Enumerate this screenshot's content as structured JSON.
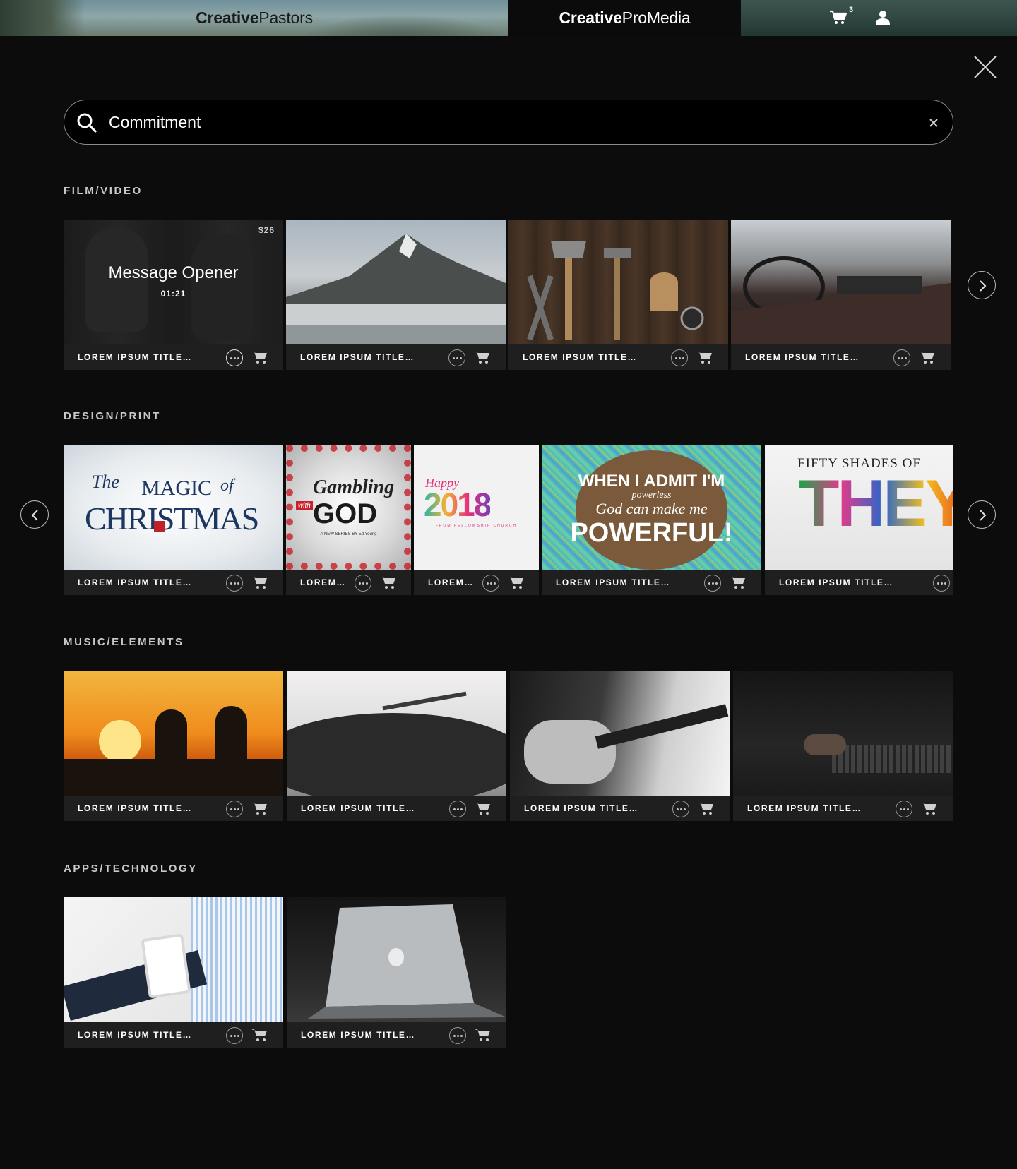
{
  "header": {
    "brand_left": {
      "bold": "Creative",
      "light": "Pastors"
    },
    "brand_center": {
      "bold": "Creative",
      "light": "ProMedia"
    },
    "cart_count": "3",
    "icons": [
      "cart-icon",
      "user-icon",
      "close-icon"
    ]
  },
  "search": {
    "value": "Commitment",
    "icon": "search-icon",
    "clear_icon": "clear-icon"
  },
  "sections": {
    "film": {
      "title": "FILM/VIDEO",
      "items": [
        {
          "title": "LOREM IPSUM TITLE…",
          "overlay_title": "Message Opener",
          "duration": "01:21",
          "price": "$26"
        },
        {
          "title": "LOREM IPSUM TITLE…"
        },
        {
          "title": "LOREM IPSUM TITLE…"
        },
        {
          "title": "LOREM IPSUM TITLE…"
        }
      ]
    },
    "design": {
      "title": "DESIGN/PRINT",
      "items": [
        {
          "title": "LOREM IPSUM TITLE…",
          "art_line1": "The",
          "art_line2": "MAGIC",
          "art_line3": "of",
          "art_line4": "CHRISTMAS"
        },
        {
          "title": "LOREM…",
          "art_line1": "Gambling",
          "art_line2": "with",
          "art_line3": "GOD",
          "art_line4": "A NEW SERIES BY Ed Young"
        },
        {
          "title": "LOREM…",
          "art_line1": "Happy",
          "art_line2": "2018",
          "art_line3": "FROM FELLOWSHIP CHURCH"
        },
        {
          "title": "LOREM IPSUM TITLE…",
          "art_line1": "WHEN I ADMIT I'M",
          "art_line2": "powerless",
          "art_line3": "God can make me",
          "art_line4": "POWERFUL!"
        },
        {
          "title": "LOREM IPSUM TITLE…",
          "art_line1": "FIFTY SHADES OF",
          "art_line2": "THEY"
        }
      ]
    },
    "music": {
      "title": "MUSIC/ELEMENTS",
      "items": [
        {
          "title": "LOREM IPSUM TITLE…"
        },
        {
          "title": "LOREM IPSUM TITLE…"
        },
        {
          "title": "LOREM IPSUM TITLE…"
        },
        {
          "title": "LOREM IPSUM TITLE…"
        }
      ]
    },
    "apps": {
      "title": "APPS/TECHNOLOGY",
      "items": [
        {
          "title": "LOREM IPSUM TITLE…"
        },
        {
          "title": "LOREM IPSUM TITLE…"
        }
      ]
    }
  },
  "colors": {
    "background": "#0c0c0c",
    "card_bar": "#1f1f1f",
    "section_title": "#c9c9c9"
  }
}
